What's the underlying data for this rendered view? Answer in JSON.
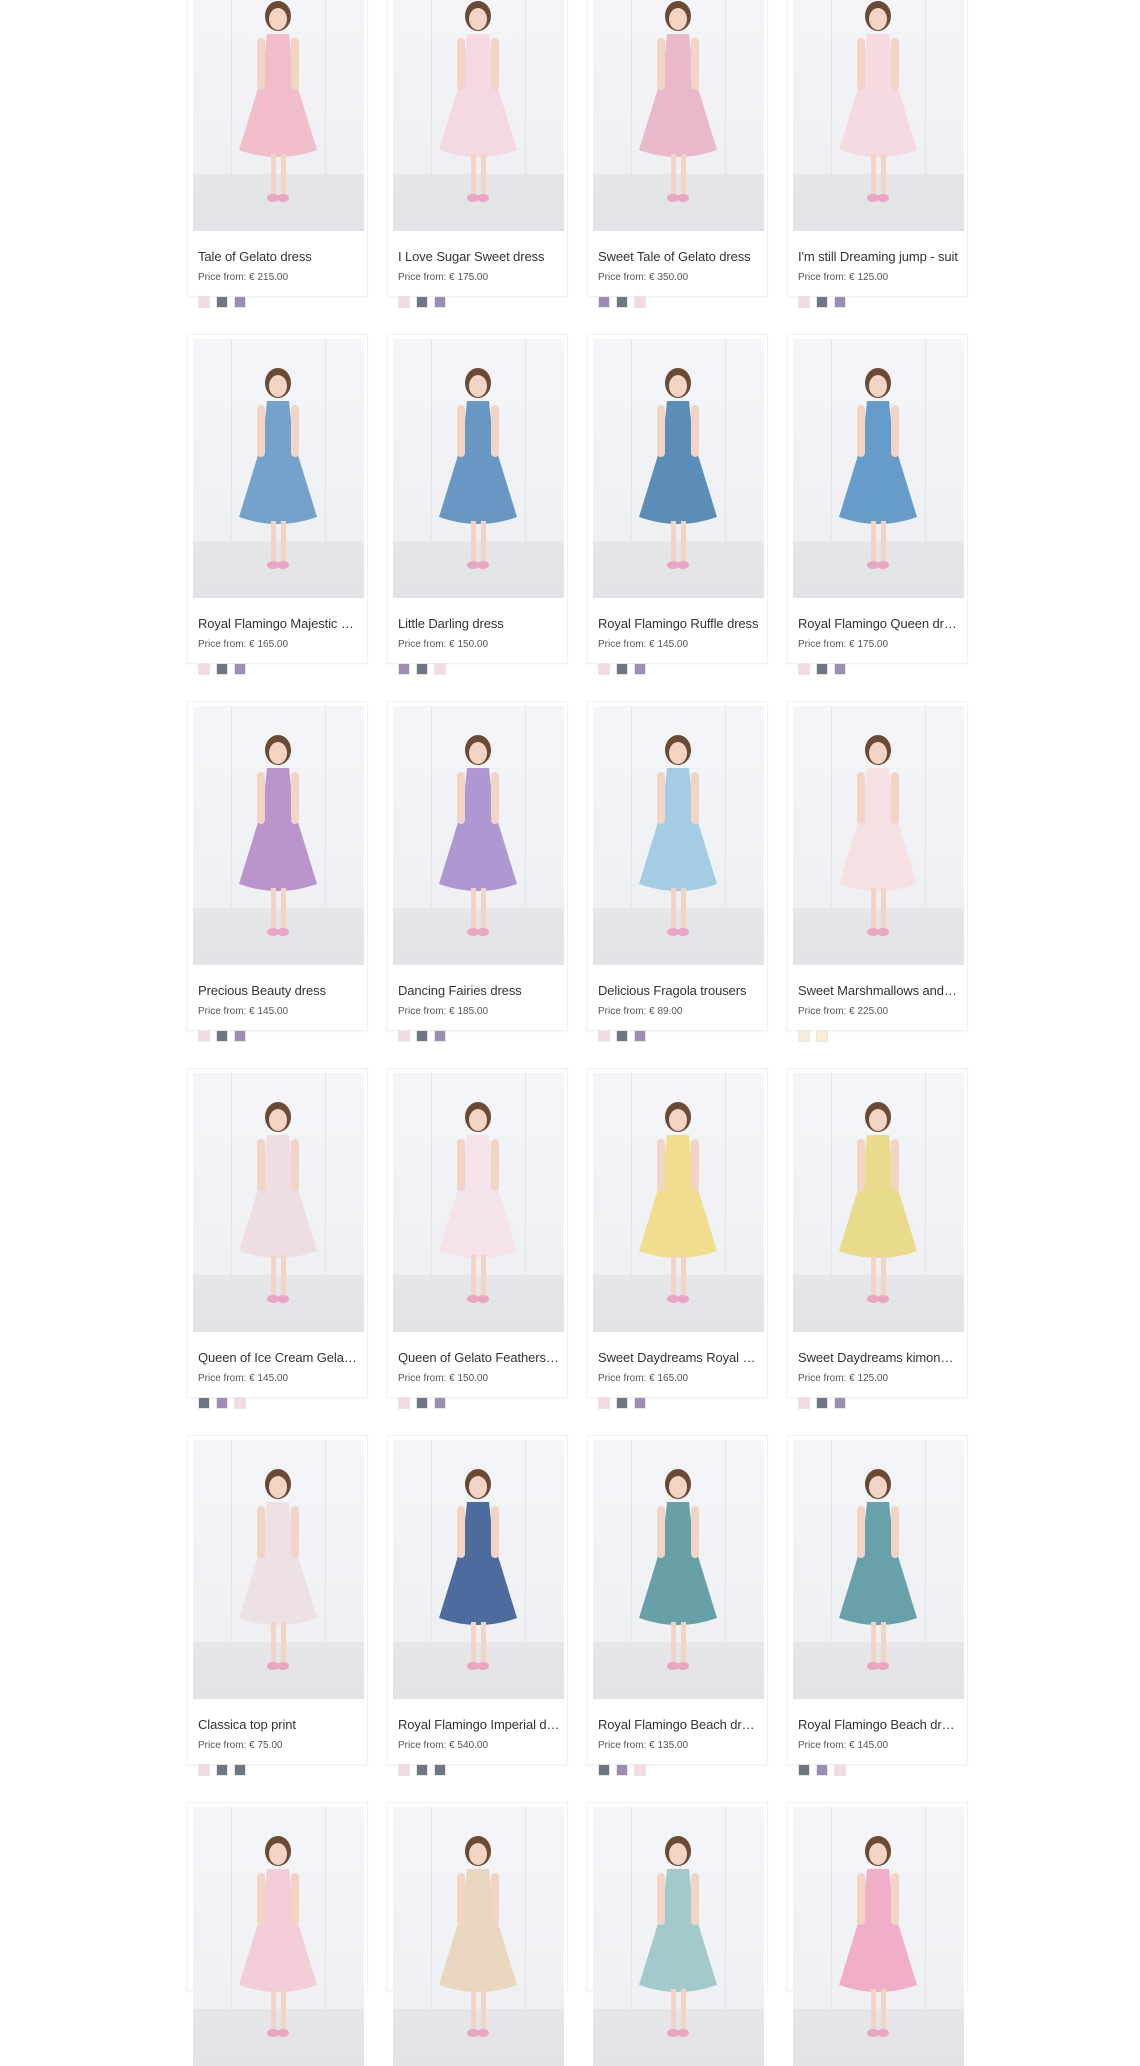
{
  "swatch_colors": {
    "pink": "#f3d9e2",
    "grey": "#6e7682",
    "purple": "#9b8db3",
    "cream": "#f6efd6"
  },
  "products": [
    {
      "name": "Tale of Gelato dress",
      "price": "Price from: € 215.00",
      "dress": "#f2b8c6",
      "swatches": [
        "pink",
        "grey",
        "purple"
      ]
    },
    {
      "name": "I Love Sugar Sweet dress",
      "price": "Price from: € 175.00",
      "dress": "#f4d6df",
      "swatches": [
        "pink",
        "grey",
        "purple"
      ]
    },
    {
      "name": "Sweet Tale of Gelato dress",
      "price": "Price from: € 350.00",
      "dress": "#e9b3c7",
      "swatches": [
        "purple",
        "grey",
        "pink"
      ]
    },
    {
      "name": "I'm still Dreaming jump - suit",
      "price": "Price from: € 125.00",
      "dress": "#f5d8e0",
      "swatches": [
        "pink",
        "grey",
        "purple"
      ]
    },
    {
      "name": "Royal Flamingo Majestic dress",
      "price": "Price from: € 165.00",
      "dress": "#6a9bc7",
      "swatches": [
        "pink",
        "grey",
        "purple"
      ]
    },
    {
      "name": "Little Darling dress",
      "price": "Price from: € 150.00",
      "dress": "#5d8fbe",
      "swatches": [
        "purple",
        "grey",
        "pink"
      ]
    },
    {
      "name": "Royal Flamingo Ruffle dress",
      "price": "Price from: € 145.00",
      "dress": "#4e86b0",
      "swatches": [
        "pink",
        "grey",
        "purple"
      ]
    },
    {
      "name": "Royal Flamingo Queen dress",
      "price": "Price from: € 175.00",
      "dress": "#5b94c4",
      "swatches": [
        "pink",
        "grey",
        "purple"
      ]
    },
    {
      "name": "Precious Beauty dress",
      "price": "Price from: € 145.00",
      "dress": "#b48cc9",
      "swatches": [
        "pink",
        "grey",
        "purple"
      ]
    },
    {
      "name": "Dancing Fairies dress",
      "price": "Price from: € 185.00",
      "dress": "#a98fd0",
      "swatches": [
        "pink",
        "grey",
        "purple"
      ]
    },
    {
      "name": "Delicious Fragola trousers",
      "price": "Price from: € 89.00",
      "dress": "#9dc9e0",
      "swatches": [
        "pink",
        "grey",
        "purple"
      ]
    },
    {
      "name": "Sweet Marshmallows and Strawberries dress",
      "price": "Price from: € 225.00",
      "dress": "#f5dfe1",
      "swatches": [
        "cream",
        "cream"
      ]
    },
    {
      "name": "Queen of Ice Cream Gelato dress",
      "price": "Price from: € 145.00",
      "dress": "#efdbe2",
      "swatches": [
        "grey",
        "purple",
        "pink"
      ]
    },
    {
      "name": "Queen of Gelato Feathers dress",
      "price": "Price from: € 150.00",
      "dress": "#f4e3e8",
      "swatches": [
        "pink",
        "grey",
        "purple"
      ]
    },
    {
      "name": "Sweet Daydreams Royal kimono",
      "price": "Price from: € 165.00",
      "dress": "#f0dc84",
      "swatches": [
        "pink",
        "grey",
        "purple"
      ]
    },
    {
      "name": "Sweet Daydreams kimono jacket",
      "price": "Price from: € 125.00",
      "dress": "#e8d982",
      "swatches": [
        "pink",
        "grey",
        "purple"
      ]
    },
    {
      "name": "Classica top print",
      "price": "Price from: € 75.00",
      "dress": "#eedfe4",
      "swatches": [
        "pink",
        "grey",
        "grey"
      ]
    },
    {
      "name": "Royal Flamingo Imperial dress",
      "price": "Price from: € 540.00",
      "dress": "#3f5f95",
      "swatches": [
        "pink",
        "grey",
        "grey"
      ]
    },
    {
      "name": "Royal Flamingo Beach dress",
      "price": "Price from: € 135.00",
      "dress": "#5b9a9f",
      "swatches": [
        "grey",
        "purple",
        "pink"
      ]
    },
    {
      "name": "Royal Flamingo Beach dress",
      "price": "Price from: € 145.00",
      "dress": "#5d9aa4",
      "swatches": [
        "grey",
        "purple",
        "pink"
      ]
    }
  ],
  "partial": [
    {
      "dress": "#f2c9d4"
    },
    {
      "dress": "#e8d4b8"
    },
    {
      "dress": "#9bc7c9"
    },
    {
      "dress": "#f1a8c3"
    }
  ]
}
